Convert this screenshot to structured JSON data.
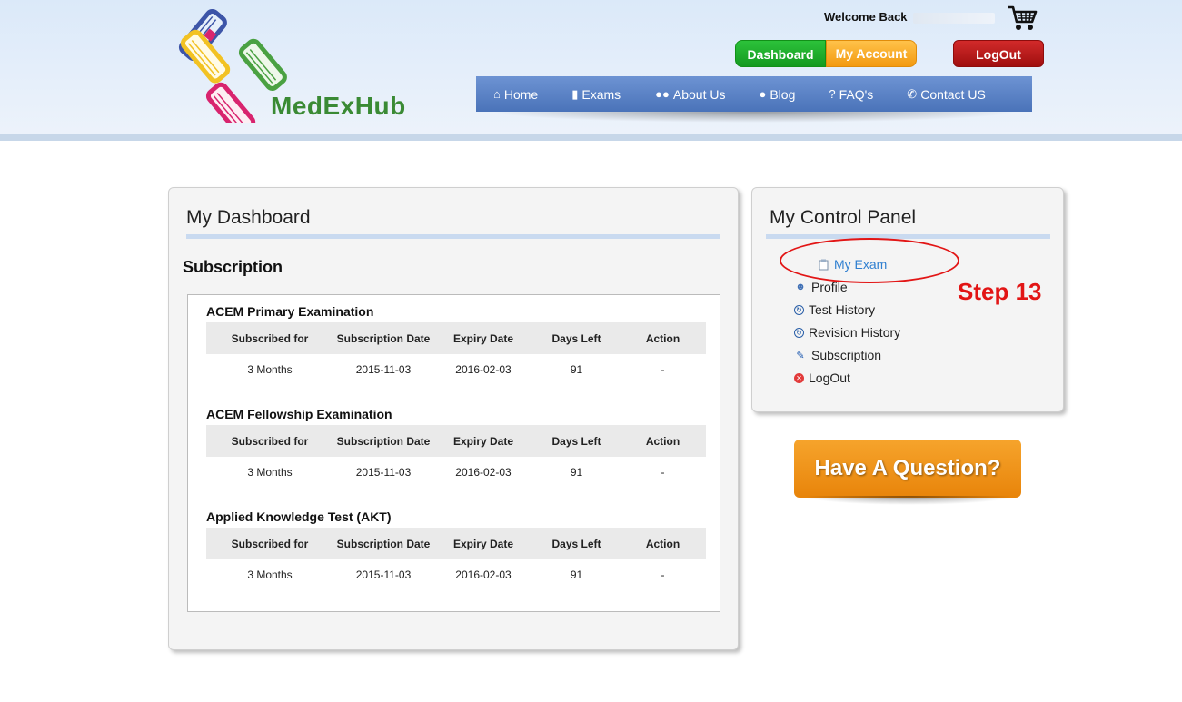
{
  "header": {
    "brand": "MedExHub",
    "welcome_label": "Welcome Back",
    "dashboard_label": "Dashboard",
    "account_label": "My Account",
    "logout_label": "LogOut"
  },
  "nav": [
    {
      "label": "Home",
      "icon": "home-icon"
    },
    {
      "label": "Exams",
      "icon": "book-icon"
    },
    {
      "label": "About Us",
      "icon": "users-icon"
    },
    {
      "label": "Blog",
      "icon": "chat-icon"
    },
    {
      "label": "FAQ's",
      "icon": "question-icon"
    },
    {
      "label": "Contact US",
      "icon": "phone-icon"
    }
  ],
  "dashboard": {
    "title": "My Dashboard",
    "subscription_heading": "Subscription",
    "columns": [
      "Subscribed for",
      "Subscription Date",
      "Expiry Date",
      "Days Left",
      "Action"
    ],
    "exams": [
      {
        "title": "ACEM Primary Examination",
        "row": [
          "3 Months",
          "2015-11-03",
          "2016-02-03",
          "91",
          "-"
        ]
      },
      {
        "title": "ACEM Fellowship Examination",
        "row": [
          "3 Months",
          "2015-11-03",
          "2016-02-03",
          "91",
          "-"
        ]
      },
      {
        "title": "Applied Knowledge Test (AKT)",
        "row": [
          "3 Months",
          "2015-11-03",
          "2016-02-03",
          "91",
          "-"
        ]
      }
    ]
  },
  "control_panel": {
    "title": "My Control Panel",
    "items": [
      {
        "label": "My Exam",
        "icon": "clipboard-icon"
      },
      {
        "label": "Profile",
        "icon": "user-icon"
      },
      {
        "label": "Test History",
        "icon": "history-icon"
      },
      {
        "label": "Revision History",
        "icon": "history-icon"
      },
      {
        "label": "Subscription",
        "icon": "edit-icon"
      },
      {
        "label": "LogOut",
        "icon": "logout-icon"
      }
    ]
  },
  "annotation": {
    "step_label": "Step 13"
  },
  "question_button": {
    "label": "Have A Question?"
  },
  "colors": {
    "nav": "#5b82c6",
    "dashboard_btn": "#1fae2c",
    "account_btn": "#f7a922",
    "logout_btn": "#b81818",
    "annotation": "#e21515",
    "question_btn": "#f0951a"
  }
}
